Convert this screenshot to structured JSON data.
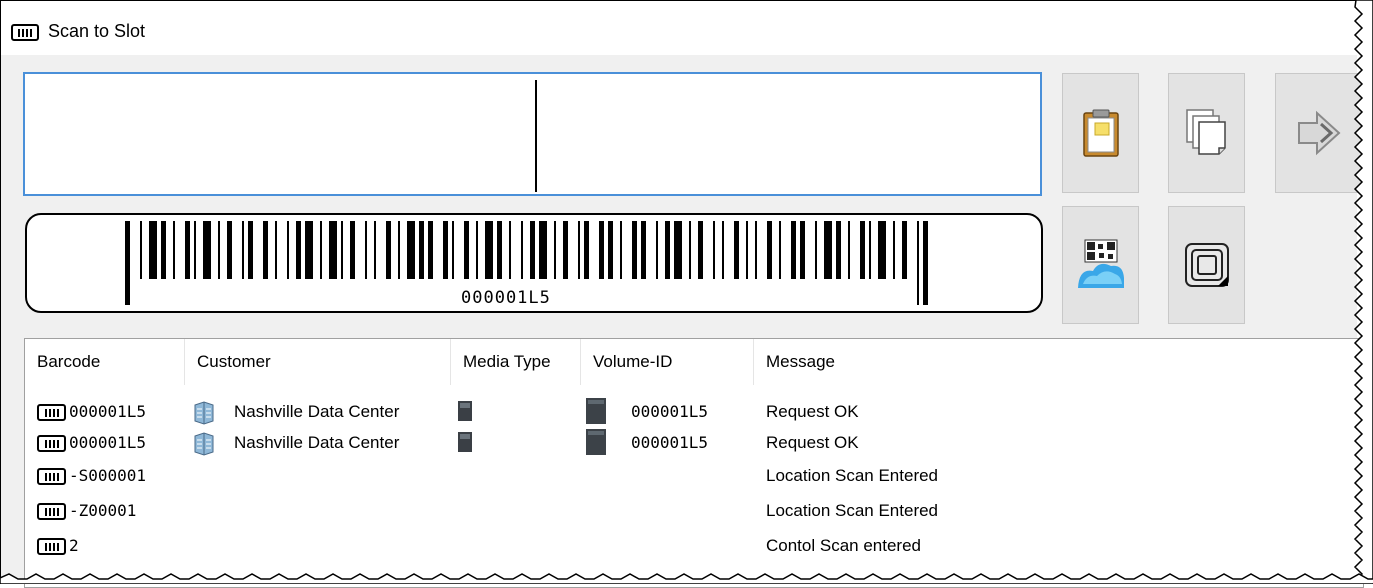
{
  "window": {
    "title": "Scan to Slot"
  },
  "scan_input": {
    "value": ""
  },
  "barcode_preview": {
    "text": "000001L5"
  },
  "toolbar": {
    "buttons": [
      {
        "icon": "clipboard-icon"
      },
      {
        "icon": "copy-pages-icon"
      },
      {
        "icon": "exit-arrow-icon"
      },
      {
        "icon": "qr-cloud-icon"
      },
      {
        "icon": "rfid-tag-icon"
      }
    ]
  },
  "list": {
    "columns": [
      "Barcode",
      "Customer",
      "Media Type",
      "Volume-ID",
      "Message"
    ],
    "rows": [
      {
        "barcode": "000001L5",
        "customer": "Nashville Data Center",
        "volume_id": "000001L5",
        "message": "Request OK"
      },
      {
        "barcode": "000001L5",
        "customer": "Nashville Data Center",
        "volume_id": "000001L5",
        "message": "Request OK"
      },
      {
        "barcode": "-S000001",
        "customer": "",
        "volume_id": "",
        "message": "Location Scan Entered"
      },
      {
        "barcode": "-Z00001",
        "customer": "",
        "volume_id": "",
        "message": "Location Scan Entered"
      },
      {
        "barcode": "2",
        "customer": "",
        "volume_id": "",
        "message": "Contol Scan entered"
      }
    ]
  }
}
